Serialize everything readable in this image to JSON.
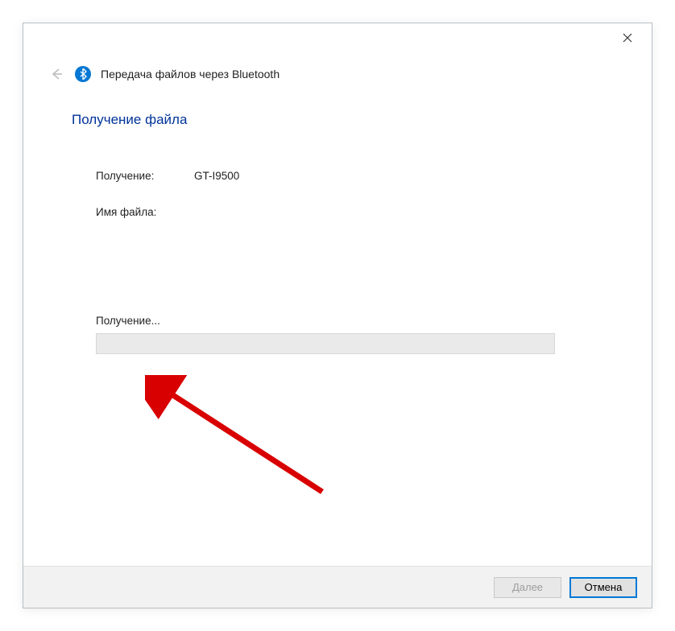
{
  "window": {
    "title": "Передача файлов через Bluetooth"
  },
  "heading": "Получение файла",
  "info": {
    "receiving_label": "Получение:",
    "receiving_value": "GT-I9500",
    "filename_label": "Имя файла:",
    "filename_value": ""
  },
  "progress": {
    "label": "Получение..."
  },
  "footer": {
    "next_label": "Далее",
    "cancel_label": "Отмена"
  },
  "icons": {
    "close": "close-icon",
    "back": "back-arrow-icon",
    "bluetooth": "bluetooth-icon"
  }
}
